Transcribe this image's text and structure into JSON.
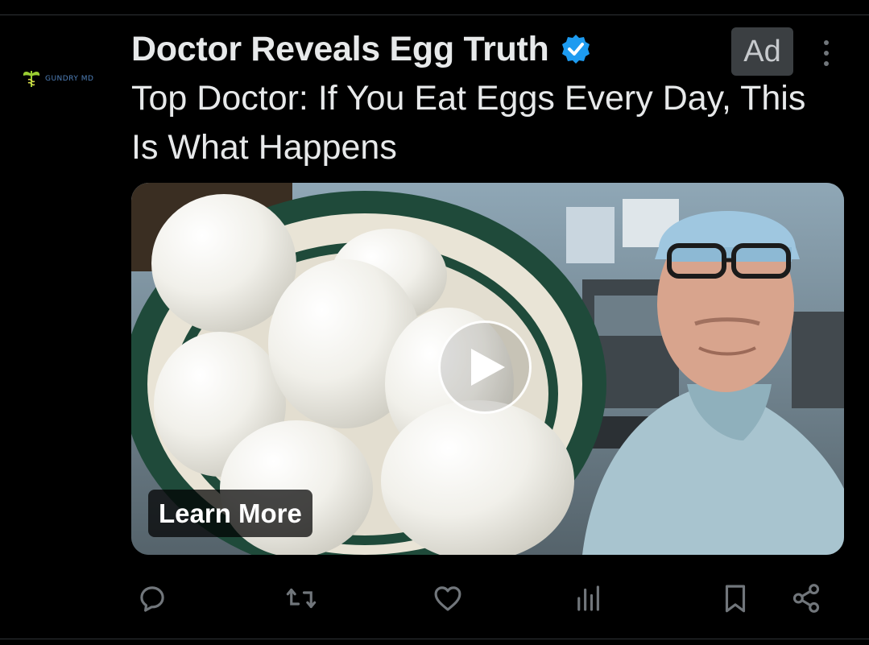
{
  "post": {
    "author": {
      "display_name": "Doctor Reveals Egg Truth",
      "avatar_brand": "GUNDRY MD",
      "avatar_icon": "caduceus-leaf-icon",
      "verified_icon": "verified-badge-icon",
      "verified_color": "#1d9bf0"
    },
    "ad_label": "Ad",
    "more_icon": "more-vertical-icon",
    "headline": "Top Doctor: If You Eat Eggs Every Day, This Is What Happens",
    "media": {
      "description_icon": "video-thumbnail",
      "play_icon": "play-icon",
      "cta_label": "Learn More"
    },
    "actions": {
      "reply_icon": "reply-icon",
      "repost_icon": "repost-icon",
      "like_icon": "heart-icon",
      "views_icon": "views-icon",
      "bookmark_icon": "bookmark-icon",
      "share_icon": "share-icon"
    }
  },
  "theme": {
    "background": "#000000",
    "text_primary": "#e7e9ea",
    "text_secondary": "#71767b",
    "divider": "#2f3336"
  }
}
